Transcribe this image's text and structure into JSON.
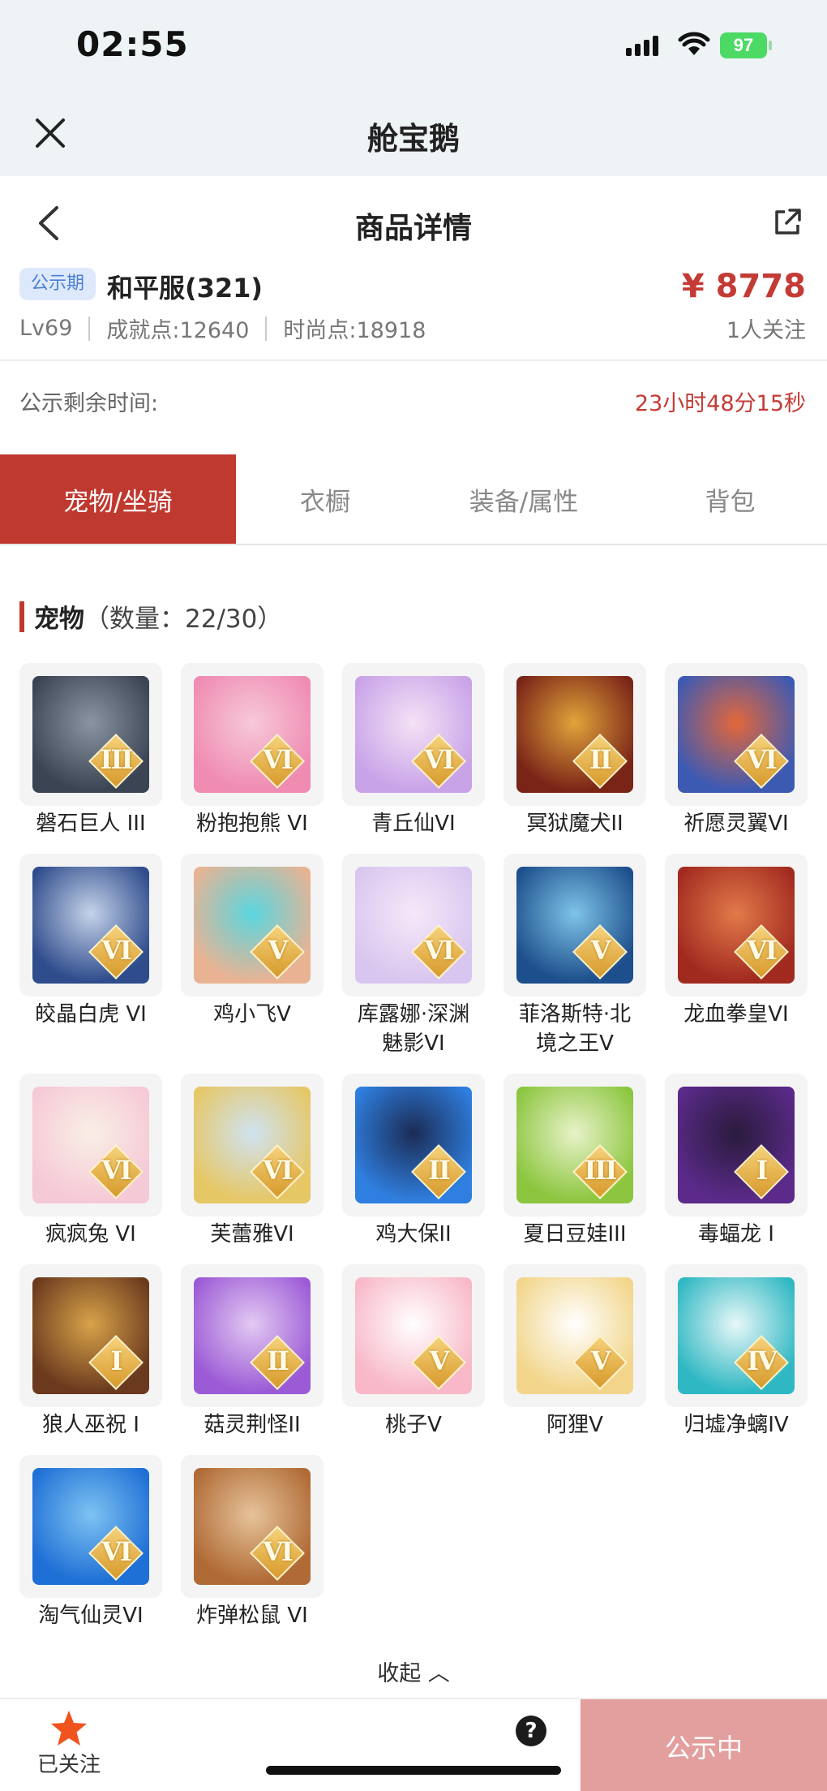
{
  "status_bar": {
    "time": "02:55",
    "battery": "97"
  },
  "app": {
    "title": "舱宝鹅"
  },
  "page": {
    "title": "商品详情"
  },
  "product": {
    "badge": "公示期",
    "server": "和平服(321)",
    "price": "¥ 8778",
    "level": "Lv69",
    "achievement": "成就点:12640",
    "fashion": "时尚点:18918",
    "followers": "1人关注"
  },
  "countdown": {
    "label": "公示剩余时间:",
    "value": "23小时48分15秒"
  },
  "tabs": [
    {
      "label": "宠物/坐骑"
    },
    {
      "label": "衣橱"
    },
    {
      "label": "装备/属性"
    },
    {
      "label": "背包"
    }
  ],
  "pets_section": {
    "title": "宠物",
    "count": "（数量：22/30）"
  },
  "pets": [
    {
      "name": "磐石巨人 III",
      "rank": "III",
      "colors": [
        "#3b4452",
        "#8a95a3"
      ]
    },
    {
      "name": "粉抱抱熊 VI",
      "rank": "VI",
      "colors": [
        "#f08bb2",
        "#f6c9d9"
      ]
    },
    {
      "name": "青丘仙VI",
      "rank": "VI",
      "colors": [
        "#c9a3e8",
        "#f4e2f6"
      ]
    },
    {
      "name": "冥狱魔犬II",
      "rank": "II",
      "colors": [
        "#7a2418",
        "#e1a43a"
      ]
    },
    {
      "name": "祈愿灵翼VI",
      "rank": "VI",
      "colors": [
        "#3d5ab3",
        "#e4673a"
      ]
    },
    {
      "name": "皎晶白虎 VI",
      "rank": "VI",
      "colors": [
        "#2f4c8c",
        "#c5d3ea"
      ]
    },
    {
      "name": "鸡小飞V",
      "rank": "V",
      "colors": [
        "#e9b393",
        "#5ad6e0"
      ]
    },
    {
      "name": "库露娜·深渊魅影VI",
      "rank": "VI",
      "colors": [
        "#d9c6f0",
        "#f6e8f8"
      ]
    },
    {
      "name": "菲洛斯特·北境之王V",
      "rank": "V",
      "colors": [
        "#1d4f8c",
        "#7ec4e8"
      ]
    },
    {
      "name": "龙血拳皇VI",
      "rank": "VI",
      "colors": [
        "#a12a1f",
        "#e27a4a"
      ]
    },
    {
      "name": "疯疯兔 VI",
      "rank": "VI",
      "colors": [
        "#f6c9d6",
        "#f9efe6"
      ]
    },
    {
      "name": "芙蕾雅VI",
      "rank": "VI",
      "colors": [
        "#e6c766",
        "#cfe3f2"
      ]
    },
    {
      "name": "鸡大保II",
      "rank": "II",
      "colors": [
        "#2f7fe0",
        "#1b2c55"
      ]
    },
    {
      "name": "夏日豆娃III",
      "rank": "III",
      "colors": [
        "#8cc63f",
        "#e8f2c9"
      ]
    },
    {
      "name": "毒蝠龙 I",
      "rank": "I",
      "colors": [
        "#5b2a8a",
        "#2a1b3c"
      ]
    },
    {
      "name": "狼人巫祝 I",
      "rank": "I",
      "colors": [
        "#6b3a1e",
        "#d8a34a"
      ]
    },
    {
      "name": "菇灵荆怪II",
      "rank": "II",
      "colors": [
        "#9c5bd6",
        "#e3c9f2"
      ]
    },
    {
      "name": "桃子V",
      "rank": "V",
      "colors": [
        "#f8b8c8",
        "#ffffff"
      ]
    },
    {
      "name": "阿狸V",
      "rank": "V",
      "colors": [
        "#f2d58a",
        "#ffffff"
      ]
    },
    {
      "name": "归墟净螭IV",
      "rank": "IV",
      "colors": [
        "#2fb8c3",
        "#e8f7f8"
      ]
    },
    {
      "name": "淘气仙灵VI",
      "rank": "VI",
      "colors": [
        "#1e6fd6",
        "#7ec3f2"
      ]
    },
    {
      "name": "炸弹松鼠 VI",
      "rank": "VI",
      "colors": [
        "#b06a35",
        "#e6c39a"
      ]
    }
  ],
  "collapse_label": "收起 ︿",
  "bottom_bar": {
    "follow_label": "已关注",
    "help": "?",
    "status_label": "公示中"
  }
}
